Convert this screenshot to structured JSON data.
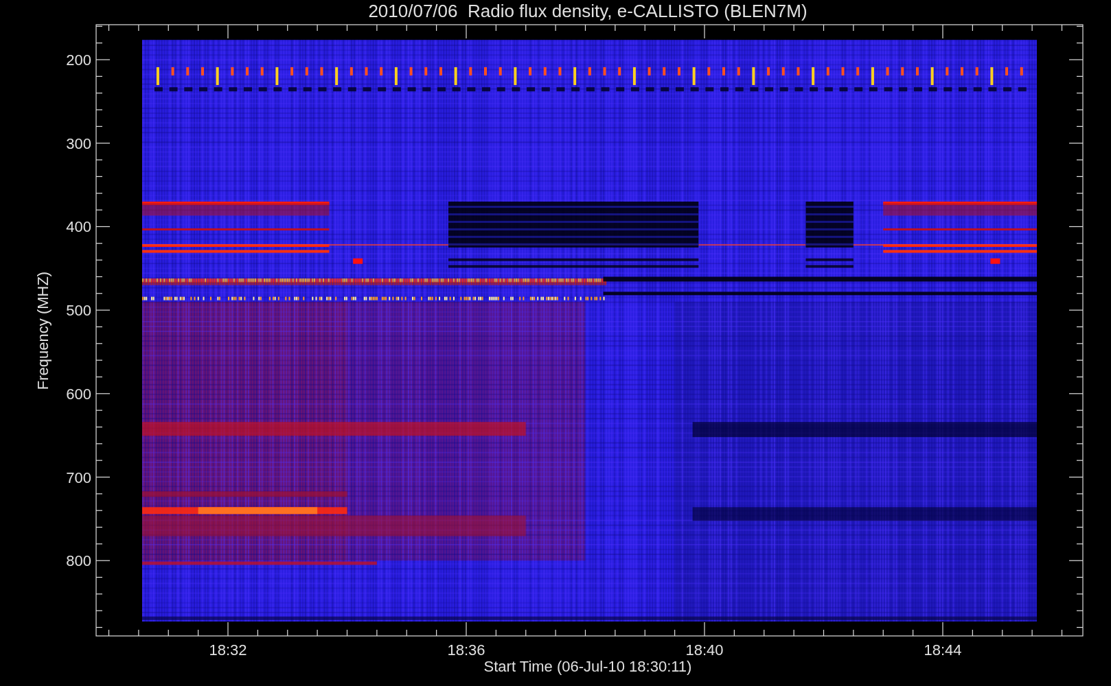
{
  "plot": {
    "title": "2010/07/06  Radio flux density, e-CALLISTO (BLEN7M)",
    "ylabel": "Frequency (MHZ)",
    "xlabel": "Start Time (06-Jul-10 18:30:11)",
    "yticks": [
      "200",
      "300",
      "400",
      "500",
      "600",
      "700",
      "800"
    ],
    "xticks": [
      "18:32",
      "18:36",
      "18:40",
      "18:44"
    ]
  }
}
